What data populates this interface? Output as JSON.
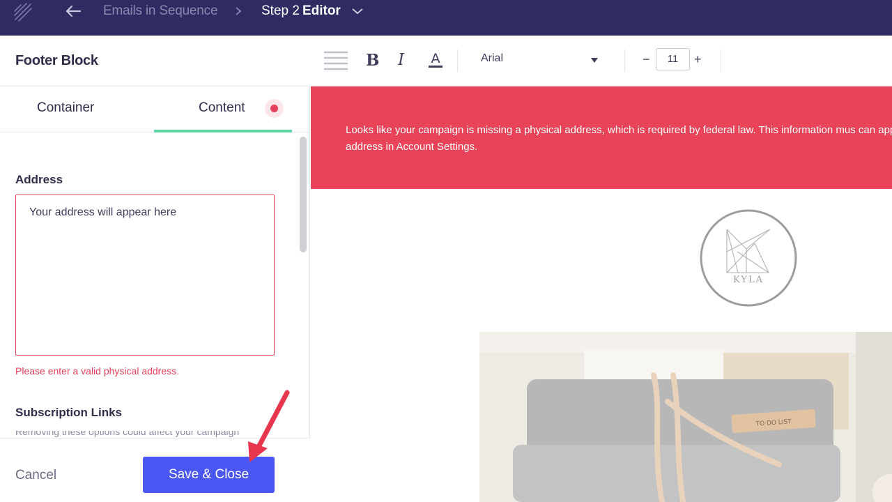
{
  "topbar": {
    "logo_icon": "brand-feather-icon",
    "back_icon": "arrow-left-icon",
    "breadcrumb": "Emails in Sequence",
    "separator_icon": "chevron-right-icon",
    "step_prefix": "Step 2",
    "step_name": "Editor",
    "dropdown_icon": "chevron-down-icon"
  },
  "toolbar": {
    "block_title": "Footer Block",
    "align_icon": "align-lines-icon",
    "bold_label": "B",
    "italic_label": "I",
    "text_color_icon": "text-color-icon",
    "font_family": "Arial",
    "font_size": "11",
    "decrease_label": "−",
    "increase_label": "+"
  },
  "panel": {
    "tabs": [
      {
        "label": "Container",
        "active": false
      },
      {
        "label": "Content",
        "active": true
      }
    ],
    "alert_icon": "alert-dot-icon",
    "address_label": "Address",
    "address_value": "Your address will appear here",
    "address_error": "Please enter a valid physical address.",
    "subscription_label": "Subscription Links",
    "subscription_desc": "Removing these options could affect your campaign",
    "cancel_label": "Cancel",
    "save_label": "Save & Close"
  },
  "preview": {
    "banner_text": "Looks like your campaign is missing a physical address, which is required by federal law. This information mus can apply it to all future campaigns by updating your address in Account Settings.",
    "logo_text": "KYLA",
    "photo_label": "TO DO LIST"
  },
  "colors": {
    "nav_bg": "#2e2c63",
    "banner": "#e84358",
    "primary": "#4b57f2",
    "tab_active": "#5fd6a6",
    "error": "#e4405a"
  }
}
